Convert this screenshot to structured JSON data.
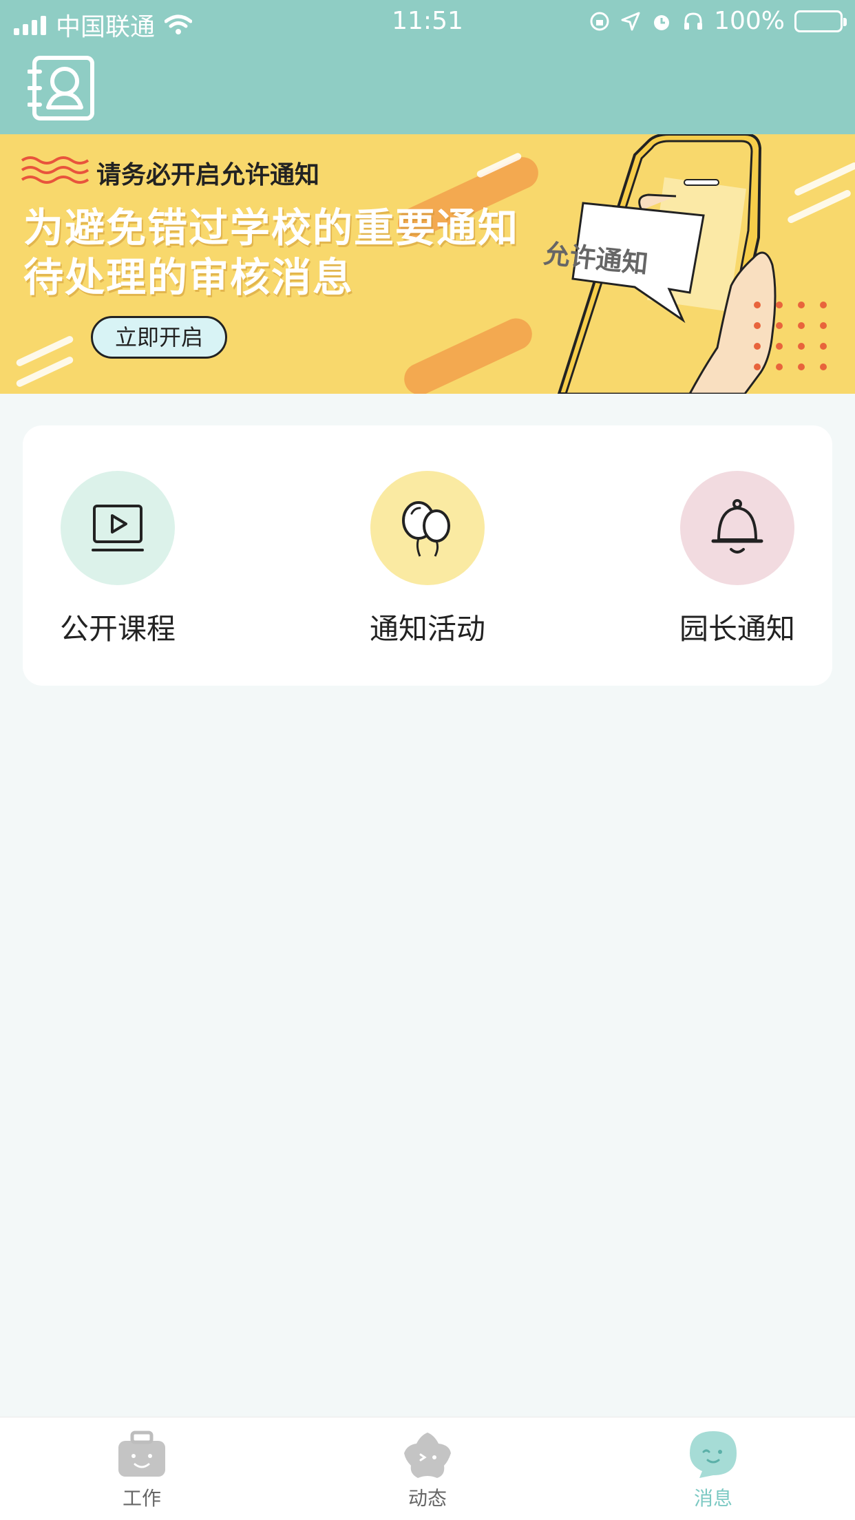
{
  "status_bar": {
    "carrier": "中国联通",
    "time": "11:51",
    "battery": "100%"
  },
  "banner": {
    "tag": "请务必开启允许通知",
    "title_line1": "为避免错过学校的重要通知",
    "title_line2": "待处理的审核消息",
    "button_label": "立即开启",
    "card_text": "允许通知"
  },
  "categories": [
    {
      "label": "公开课程",
      "icon": "video-course-icon"
    },
    {
      "label": "通知活动",
      "icon": "balloons-icon"
    },
    {
      "label": "园长通知",
      "icon": "bell-icon"
    }
  ],
  "tabbar": {
    "items": [
      {
        "label": "工作",
        "icon": "briefcase-icon",
        "active": false
      },
      {
        "label": "动态",
        "icon": "star-icon",
        "active": false
      },
      {
        "label": "消息",
        "icon": "chat-bubble-icon",
        "active": true
      }
    ]
  },
  "colors": {
    "header": "#8fcdc4",
    "banner": "#f8d86c",
    "accent_active": "#7cc9c3",
    "background": "#f3f8f8"
  }
}
